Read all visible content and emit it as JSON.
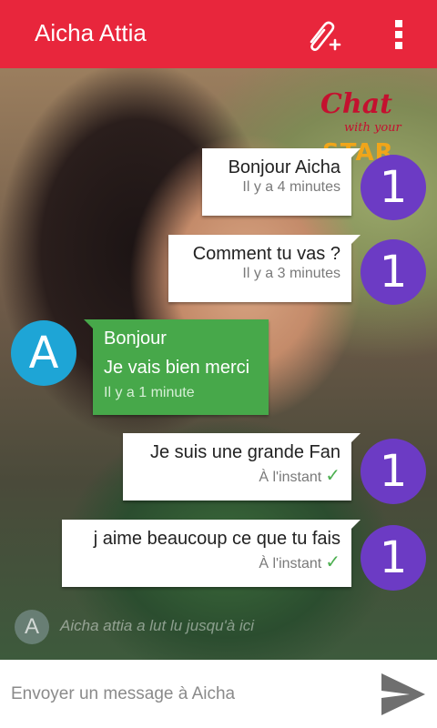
{
  "header": {
    "title": "Aicha Attia",
    "attach_icon": "attach-plus-icon",
    "menu_icon": "overflow-menu-icon",
    "color": "#e8263c"
  },
  "logo": {
    "word1": "Chat",
    "word2": "with your",
    "word3": "STAR"
  },
  "messages": [
    {
      "direction": "out",
      "text": "Bonjour Aicha",
      "time": "Il y a 4 minutes",
      "avatar": "1"
    },
    {
      "direction": "out",
      "text": "Comment tu vas ?",
      "time": "Il y a 3 minutes",
      "avatar": "1"
    },
    {
      "direction": "in",
      "line1": "Bonjour",
      "line2": "Je vais bien merci",
      "time": "Il y a 1 minute",
      "avatar": "A"
    },
    {
      "direction": "out",
      "text": "Je suis une grande Fan",
      "time": "À l'instant",
      "avatar": "1",
      "status": "sent"
    },
    {
      "direction": "out",
      "text": "j aime beaucoup ce que tu fais",
      "time": "À l'instant",
      "avatar": "1",
      "status": "sent"
    }
  ],
  "typing": {
    "avatar": "A",
    "text": "Aicha attia a lut lu jusqu'à ici"
  },
  "composer": {
    "placeholder": "Envoyer un message à Aicha",
    "send_icon": "send-icon"
  },
  "colors": {
    "accent": "#e8263c",
    "my_avatar": "#6c3bc4",
    "their_avatar": "#1ea5d6",
    "incoming_bubble": "#47a84a",
    "read_check": "#4caf50"
  }
}
